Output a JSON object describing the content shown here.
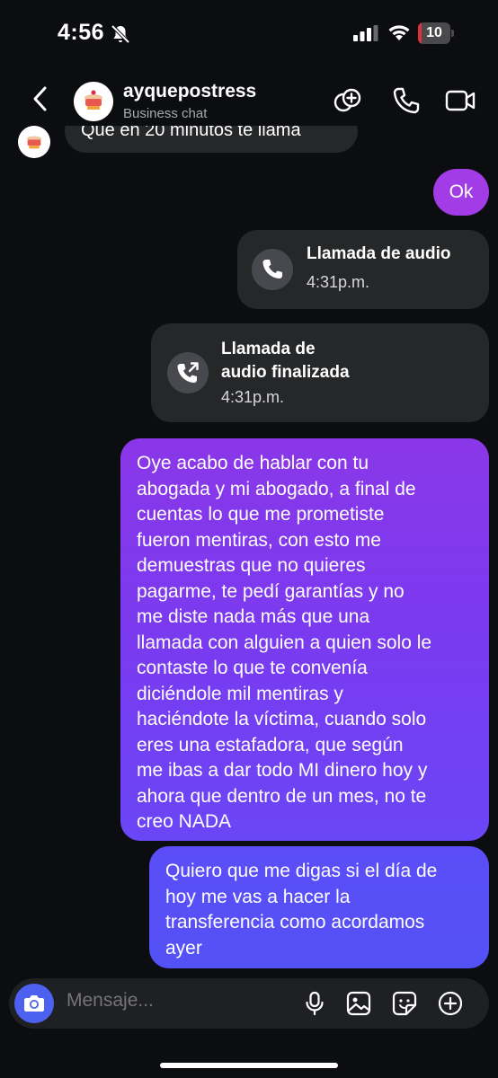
{
  "status_bar": {
    "time": "4:56",
    "battery_level": "10",
    "battery_fraction": 0.1
  },
  "header": {
    "contact_name": "ayquepostress",
    "contact_subtitle": "Business chat"
  },
  "messages": {
    "partial_incoming": "Que en 20 minutos te llama",
    "ok": "Ok",
    "call_1": {
      "title": "Llamada de audio",
      "time": "4:31p.m."
    },
    "call_2": {
      "title_line1": "Llamada de",
      "title_line2": "audio finalizada",
      "time": "4:31p.m."
    },
    "long_msg_lines": [
      "Oye acabo de hablar con tu",
      "abogada y mi abogado, a final de",
      "cuentas lo que me prometiste",
      "fueron mentiras, con esto me",
      "demuestras que no quieres",
      "pagarme, te pedí garantías y no",
      "me diste nada más que una",
      "llamada con alguien a quien solo le",
      "contaste lo que te convenía",
      "diciéndole mil mentiras y",
      "haciéndote la víctima, cuando solo",
      "eres una estafadora, que según",
      "me ibas a dar todo MI dinero hoy y",
      "ahora que dentro de un mes, no te",
      "creo NADA"
    ],
    "last_msg_lines": [
      "Quiero que me digas si el día de",
      "hoy me vas a hacer la",
      "transferencia como acordamos",
      "ayer"
    ]
  },
  "composer": {
    "placeholder": "Mensaje..."
  },
  "colors": {
    "ok_bubble": "#a23ce6",
    "gradient_top": "#8a37e8",
    "gradient_bottom": "#5352f6",
    "camera_button": "#4d61f0",
    "battery_low": "#e0313a"
  }
}
